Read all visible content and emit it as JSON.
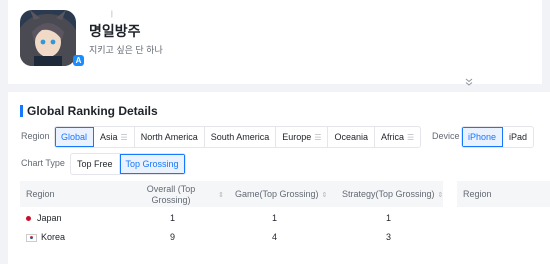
{
  "app": {
    "name": "명일방주",
    "subtitle": "지키고 싶은 단 하나",
    "mark": "|",
    "badge": "A",
    "expand_icon": "chevron-double-down"
  },
  "section": {
    "title": "Global Ranking Details"
  },
  "filters": {
    "region_label": "Region",
    "regions": [
      "Global",
      "Asia",
      "North America",
      "South America",
      "Europe",
      "Oceania",
      "Africa"
    ],
    "region_selected": "Global",
    "device_label": "Device",
    "devices": [
      "iPhone",
      "iPad"
    ],
    "device_selected": "iPhone",
    "chart_type_label": "Chart Type",
    "chart_types": [
      "Top Free",
      "Top Grossing"
    ],
    "chart_type_selected": "Top Grossing"
  },
  "table": {
    "headers": [
      "Region",
      "Overall (Top Grossing)",
      "Game(Top Grossing)",
      "Strategy(Top Grossing)",
      "Region"
    ],
    "rows": [
      {
        "region": "Japan",
        "overall": "1",
        "game": "1",
        "strategy": "1"
      },
      {
        "region": "Korea",
        "overall": "9",
        "game": "4",
        "strategy": "3"
      }
    ]
  },
  "colors": {
    "accent": "#1677ff",
    "japan_dot": "#c8102e"
  }
}
